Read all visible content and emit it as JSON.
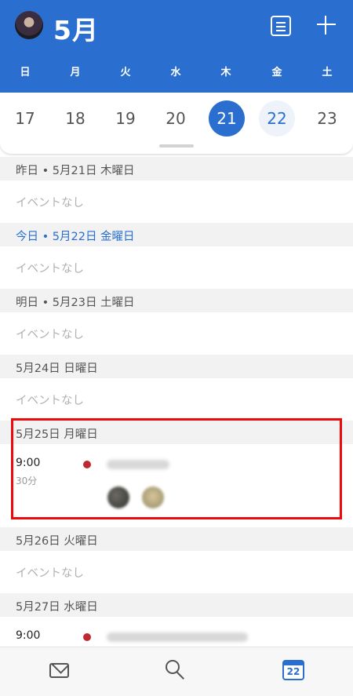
{
  "header": {
    "month": "5月",
    "weekdays": [
      "日",
      "月",
      "火",
      "水",
      "木",
      "金",
      "土"
    ]
  },
  "week": {
    "dates": [
      "17",
      "18",
      "19",
      "20",
      "21",
      "22",
      "23"
    ],
    "selected_date": "21",
    "today_date": "22"
  },
  "agenda": [
    {
      "heading": "昨日 • 5月21日 木曜日",
      "empty_text": "イベントなし"
    },
    {
      "heading": "今日 • 5月22日 金曜日",
      "empty_text": "イベントなし",
      "is_today": true
    },
    {
      "heading": "明日 • 5月23日 土曜日",
      "empty_text": "イベントなし"
    },
    {
      "heading": "5月24日 日曜日",
      "empty_text": "イベントなし"
    },
    {
      "heading": "5月25日 月曜日",
      "event": {
        "time": "9:00",
        "duration": "30分"
      }
    },
    {
      "heading": "5月26日 火曜日",
      "empty_text": "イベントなし"
    },
    {
      "heading": "5月27日 水曜日",
      "event": {
        "time": "9:00"
      }
    }
  ],
  "tabbar": {
    "calendar_badge": "22",
    "items": [
      "mail-icon",
      "search-icon",
      "calendar-icon"
    ]
  },
  "colors": {
    "accent": "#2a6fcf",
    "event_dot": "#c0282f",
    "highlight_box": "#ee0a0a"
  }
}
